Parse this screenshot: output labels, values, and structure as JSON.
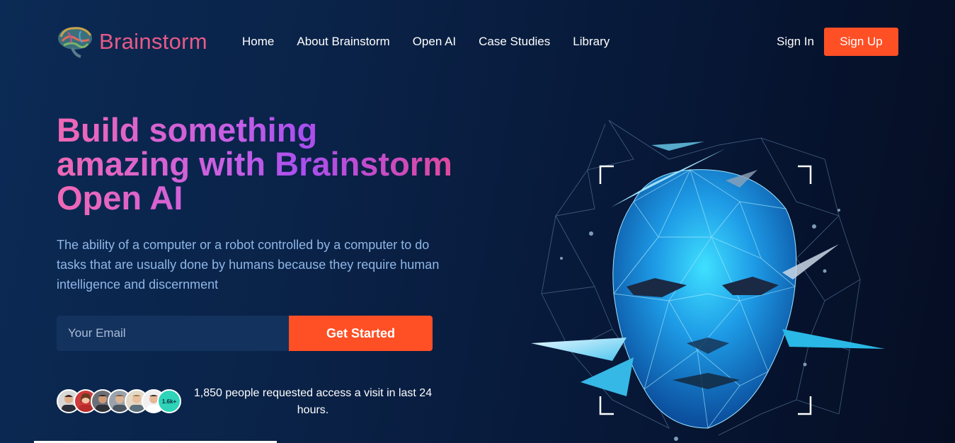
{
  "brand": {
    "name": "Brainstorm",
    "logo_icon": "brain-icon",
    "color": "#e95a86"
  },
  "nav": {
    "items": [
      {
        "label": "Home"
      },
      {
        "label": "About Brainstorm"
      },
      {
        "label": "Open AI"
      },
      {
        "label": "Case Studies"
      },
      {
        "label": "Library"
      }
    ],
    "sign_in": "Sign In",
    "sign_up": "Sign Up"
  },
  "hero": {
    "headline": "Build something amazing with Brainstorm Open AI",
    "description": "The ability of a computer or a robot controlled by a computer to do tasks that are usually done by humans because they require human intelligence and discernment",
    "email_placeholder": "Your Email",
    "cta": "Get Started",
    "avatar_count_badge": "1.6k+",
    "requested_text": "1,850 people requested access a visit in last 24 hours.",
    "art_icon": "ai-face-icon"
  },
  "colors": {
    "accent": "#ff4f25",
    "background": "#0a2247",
    "headline_pink": "#f068b4",
    "headline_purple": "#a94ff0"
  }
}
